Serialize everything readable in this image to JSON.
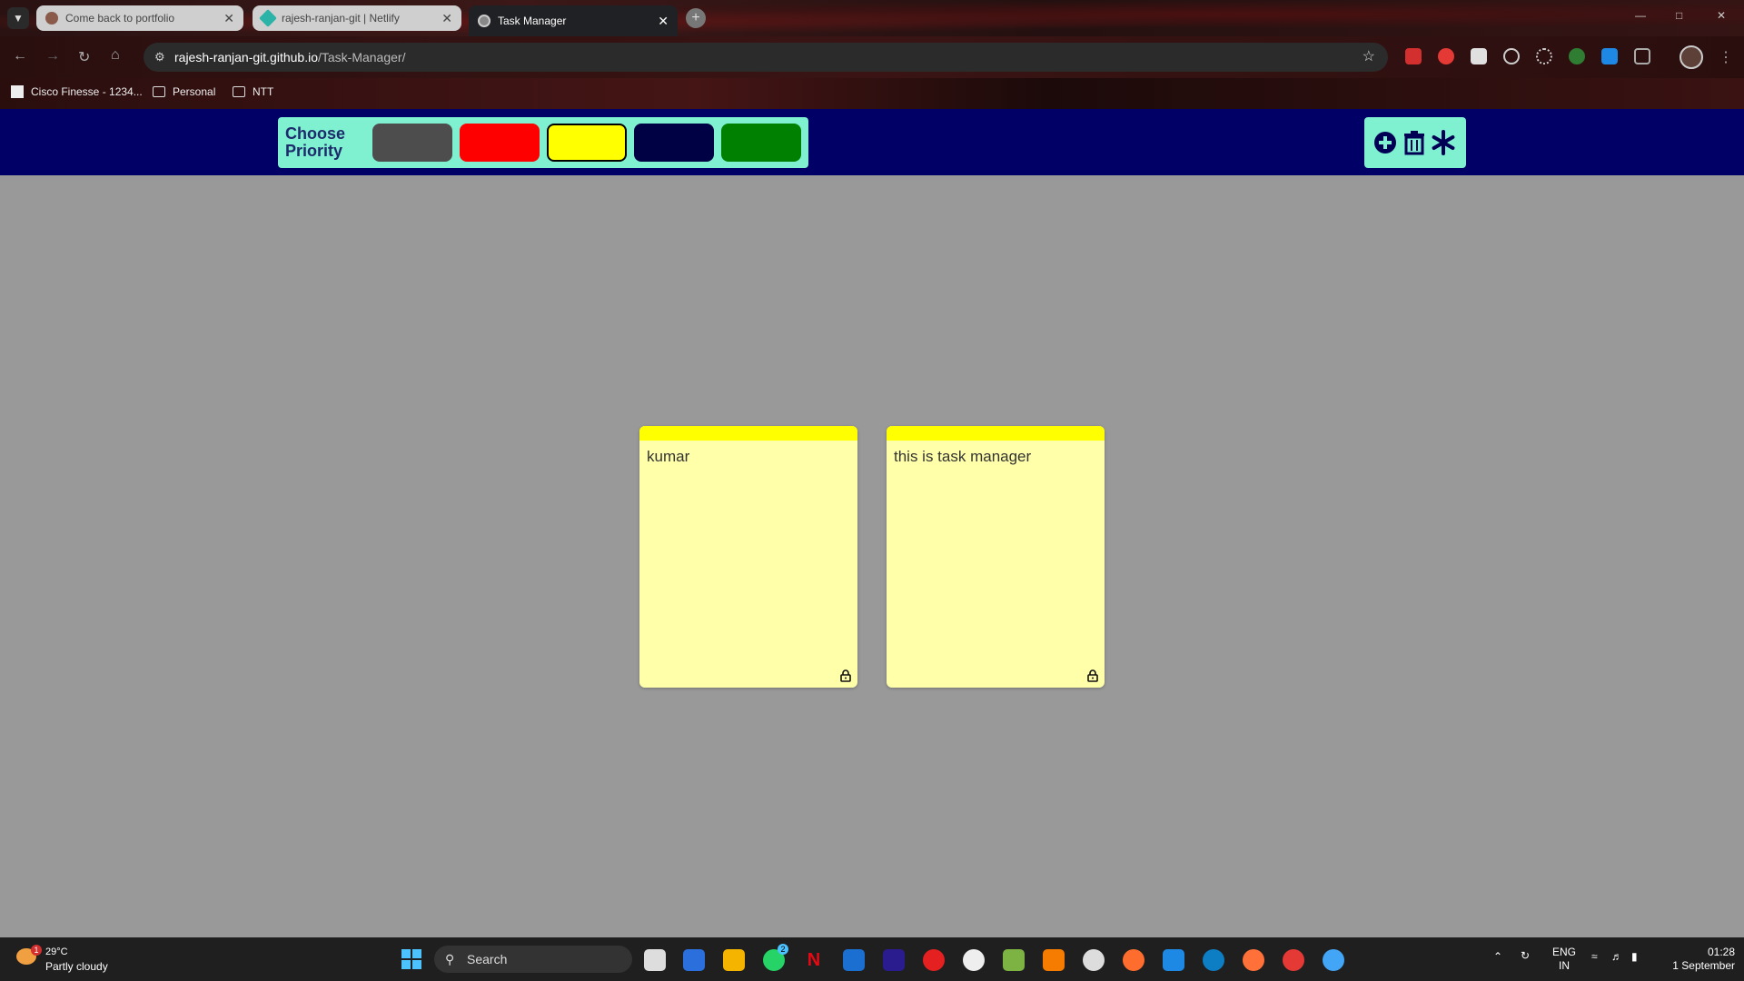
{
  "browser": {
    "tabs": [
      {
        "title": "Come back to portfolio",
        "active": false
      },
      {
        "title": "rajesh-ranjan-git | Netlify",
        "active": false
      },
      {
        "title": "Task Manager",
        "active": true
      }
    ],
    "url_host": "rajesh-ranjan-git.github.io",
    "url_path": "/Task-Manager/",
    "bookmarks": [
      "Cisco Finesse - 1234...",
      "Personal",
      "NTT"
    ],
    "extensions": [
      "abp-icon",
      "ublock-icon",
      "extension-s-icon",
      "target-icon",
      "gear-icon",
      "earth-icon",
      "notes-icon",
      "puzzle-icon"
    ]
  },
  "app": {
    "priority_label_line1": "Choose",
    "priority_label_line2": "Priority",
    "priority_colors": [
      "#4d4d4d",
      "#ff0000",
      "#ffff00",
      "#000044",
      "#008000"
    ],
    "selected_color_index": 2,
    "actions": [
      "add-icon",
      "delete-icon",
      "asterisk-icon"
    ],
    "tickets": [
      {
        "text": "kumar",
        "color": "#ffff00"
      },
      {
        "text": "this is task manager",
        "color": "#ffff00"
      }
    ]
  },
  "taskbar": {
    "weather_temp": "29°C",
    "weather_desc": "Partly cloudy",
    "weather_badge": "1",
    "search_placeholder": "Search",
    "whatsapp_badge": "2",
    "lang_line1": "ENG",
    "lang_line2": "IN",
    "time": "01:28",
    "date": "1 September"
  }
}
